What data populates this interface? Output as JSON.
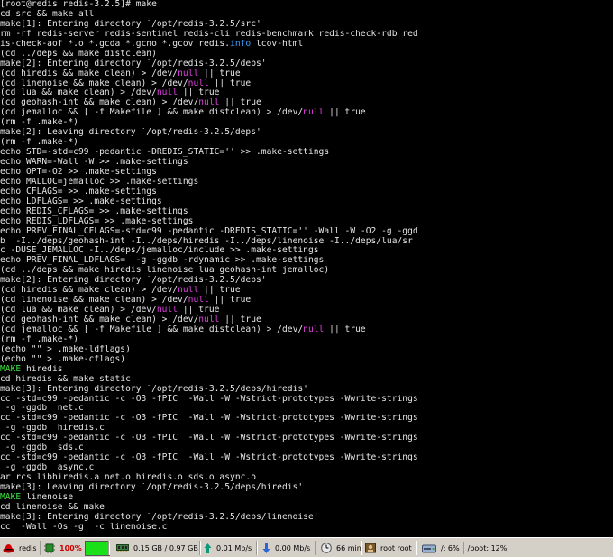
{
  "terminal": {
    "lines": [
      [
        {
          "t": "[root@redis redis-3.2.5]# make"
        }
      ],
      [
        {
          "t": "cd src && make all"
        }
      ],
      [
        {
          "t": "make[1]: Entering directory `/opt/redis-3.2.5/src'"
        }
      ],
      [
        {
          "t": "rm -rf redis-server redis-sentinel redis-cli redis-benchmark redis-check-rdb red"
        }
      ],
      [
        {
          "t": "is-check-aof *.o *.gcda *.gcno *.gcov redis."
        },
        {
          "t": "info",
          "c": "info"
        },
        {
          "t": " lcov-html"
        }
      ],
      [
        {
          "t": "(cd ../deps && make distclean)"
        }
      ],
      [
        {
          "t": "make[2]: Entering directory `/opt/redis-3.2.5/deps'"
        }
      ],
      [
        {
          "t": "(cd hiredis && make clean) > /dev/"
        },
        {
          "t": "null",
          "c": "null"
        },
        {
          "t": " || true"
        }
      ],
      [
        {
          "t": "(cd linenoise && make clean) > /dev/"
        },
        {
          "t": "null",
          "c": "null"
        },
        {
          "t": " || true"
        }
      ],
      [
        {
          "t": "(cd lua && make clean) > /dev/"
        },
        {
          "t": "null",
          "c": "null"
        },
        {
          "t": " || true"
        }
      ],
      [
        {
          "t": "(cd geohash-int && make clean) > /dev/"
        },
        {
          "t": "null",
          "c": "null"
        },
        {
          "t": " || true"
        }
      ],
      [
        {
          "t": "(cd jemalloc && [ -f Makefile ] && make distclean) > /dev/"
        },
        {
          "t": "null",
          "c": "null"
        },
        {
          "t": " || true"
        }
      ],
      [
        {
          "t": "(rm -f .make-*)"
        }
      ],
      [
        {
          "t": "make[2]: Leaving directory `/opt/redis-3.2.5/deps'"
        }
      ],
      [
        {
          "t": "(rm -f .make-*)"
        }
      ],
      [
        {
          "t": "echo STD=-std=c99 -pedantic -DREDIS_STATIC='' >> .make-settings"
        }
      ],
      [
        {
          "t": "echo WARN=-Wall -W >> .make-settings"
        }
      ],
      [
        {
          "t": "echo OPT=-O2 >> .make-settings"
        }
      ],
      [
        {
          "t": "echo MALLOC=jemalloc >> .make-settings"
        }
      ],
      [
        {
          "t": "echo CFLAGS= >> .make-settings"
        }
      ],
      [
        {
          "t": "echo LDFLAGS= >> .make-settings"
        }
      ],
      [
        {
          "t": "echo REDIS_CFLAGS= >> .make-settings"
        }
      ],
      [
        {
          "t": "echo REDIS_LDFLAGS= >> .make-settings"
        }
      ],
      [
        {
          "t": "echo PREV_FINAL_CFLAGS=-std=c99 -pedantic -DREDIS_STATIC='' -Wall -W -O2 -g -ggd"
        }
      ],
      [
        {
          "t": "b  -I../deps/geohash-int -I../deps/hiredis -I../deps/linenoise -I../deps/lua/sr"
        }
      ],
      [
        {
          "t": "c -DUSE_JEMALLOC -I../deps/jemalloc/include >> .make-settings"
        }
      ],
      [
        {
          "t": "echo PREV_FINAL_LDFLAGS=  -g -ggdb -rdynamic >> .make-settings"
        }
      ],
      [
        {
          "t": "(cd ../deps && make hiredis linenoise lua geohash-int jemalloc)"
        }
      ],
      [
        {
          "t": "make[2]: Entering directory `/opt/redis-3.2.5/deps'"
        }
      ],
      [
        {
          "t": "(cd hiredis && make clean) > /dev/"
        },
        {
          "t": "null",
          "c": "null"
        },
        {
          "t": " || true"
        }
      ],
      [
        {
          "t": "(cd linenoise && make clean) > /dev/"
        },
        {
          "t": "null",
          "c": "null"
        },
        {
          "t": " || true"
        }
      ],
      [
        {
          "t": "(cd lua && make clean) > /dev/"
        },
        {
          "t": "null",
          "c": "null"
        },
        {
          "t": " || true"
        }
      ],
      [
        {
          "t": "(cd geohash-int && make clean) > /dev/"
        },
        {
          "t": "null",
          "c": "null"
        },
        {
          "t": " || true"
        }
      ],
      [
        {
          "t": "(cd jemalloc && [ -f Makefile ] && make distclean) > /dev/"
        },
        {
          "t": "null",
          "c": "null"
        },
        {
          "t": " || true"
        }
      ],
      [
        {
          "t": "(rm -f .make-*)"
        }
      ],
      [
        {
          "t": "(echo \"\" > .make-ldflags)"
        }
      ],
      [
        {
          "t": "(echo \"\" > .make-cflags)"
        }
      ],
      [
        {
          "t": "MAKE",
          "c": "make"
        },
        {
          "t": " hiredis"
        }
      ],
      [
        {
          "t": "cd hiredis && make static"
        }
      ],
      [
        {
          "t": "make[3]: Entering directory `/opt/redis-3.2.5/deps/hiredis'"
        }
      ],
      [
        {
          "t": "cc -std=c99 -pedantic -c -O3 -fPIC  -Wall -W -Wstrict-prototypes -Wwrite-strings"
        }
      ],
      [
        {
          "t": " -g -ggdb  net.c"
        }
      ],
      [
        {
          "t": "cc -std=c99 -pedantic -c -O3 -fPIC  -Wall -W -Wstrict-prototypes -Wwrite-strings"
        }
      ],
      [
        {
          "t": " -g -ggdb  hiredis.c"
        }
      ],
      [
        {
          "t": "cc -std=c99 -pedantic -c -O3 -fPIC  -Wall -W -Wstrict-prototypes -Wwrite-strings"
        }
      ],
      [
        {
          "t": " -g -ggdb  sds.c"
        }
      ],
      [
        {
          "t": "cc -std=c99 -pedantic -c -O3 -fPIC  -Wall -W -Wstrict-prototypes -Wwrite-strings"
        }
      ],
      [
        {
          "t": " -g -ggdb  async.c"
        }
      ],
      [
        {
          "t": "ar rcs libhiredis.a net.o hiredis.o sds.o async.o"
        }
      ],
      [
        {
          "t": "make[3]: Leaving directory `/opt/redis-3.2.5/deps/hiredis'"
        }
      ],
      [
        {
          "t": "MAKE",
          "c": "make"
        },
        {
          "t": " linenoise"
        }
      ],
      [
        {
          "t": "cd linenoise && make"
        }
      ],
      [
        {
          "t": "make[3]: Entering directory `/opt/redis-3.2.5/deps/linenoise'"
        }
      ],
      [
        {
          "t": "cc  -Wall -Os -g  -c linenoise.c"
        }
      ]
    ]
  },
  "panel": {
    "hostname": "redis",
    "cpu_percent": "100%",
    "cpu_fill": 1.0,
    "memory": "0.15 GB / 0.97 GB",
    "net_up": "0.01 Mb/s",
    "net_down": "0.00 Mb/s",
    "uptime": "66 min",
    "users": "root root",
    "disk_root": "/: 6%",
    "disk_boot": "/boot: 12%",
    "colors": {
      "cpu_green": "#19e019",
      "arrow_up": "#0a9a7a",
      "arrow_down": "#2a68d8",
      "null_text": "#e040e0",
      "info_text": "#3aa0ff",
      "make_text": "#3fe33f"
    }
  }
}
